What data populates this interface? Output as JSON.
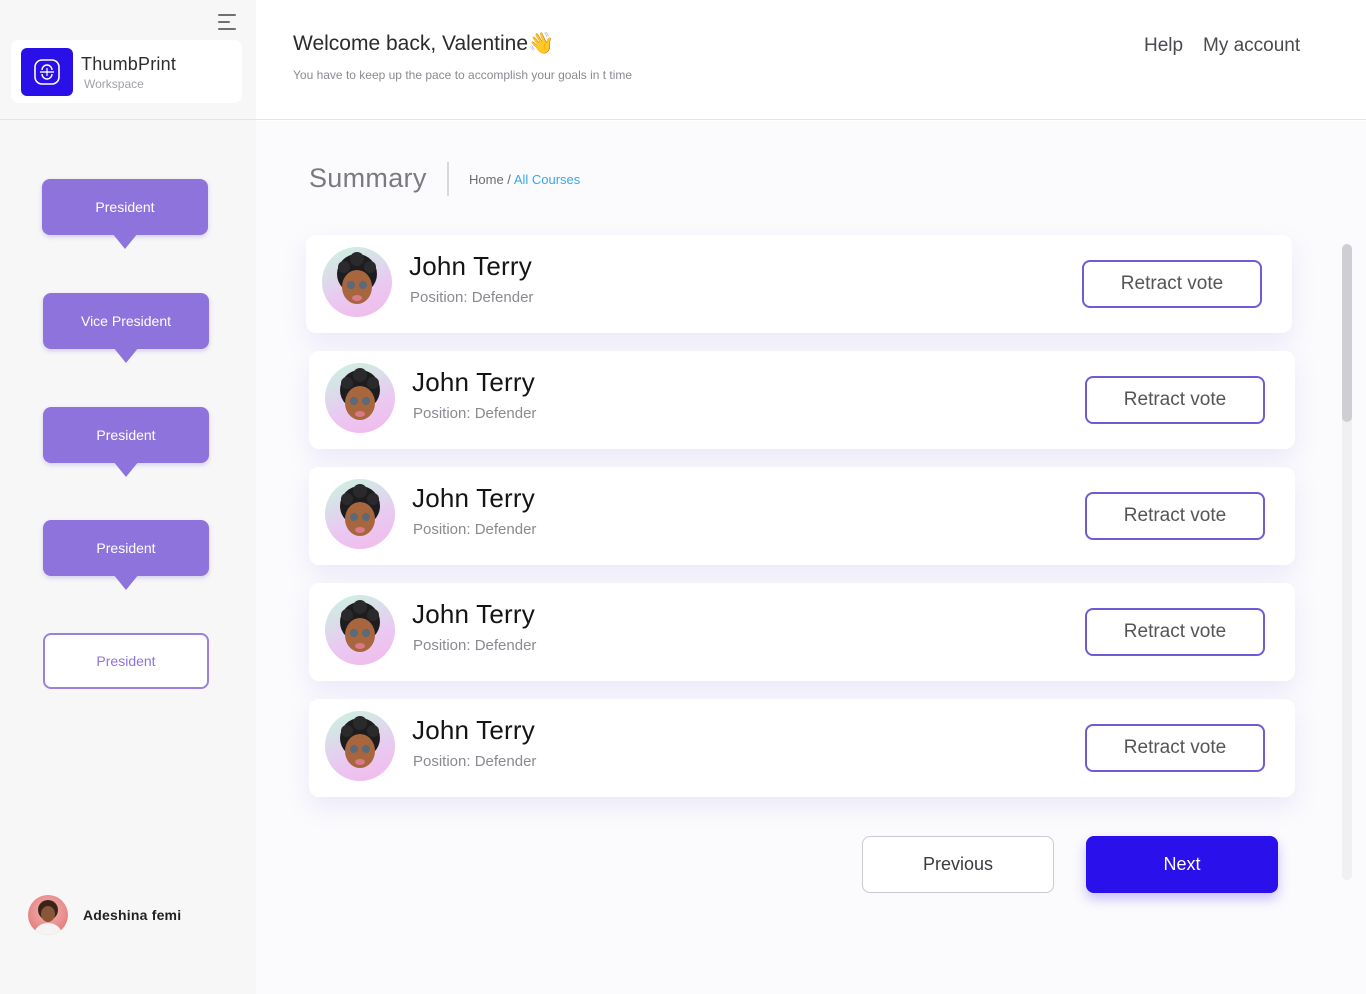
{
  "brand": {
    "name": "ThumbPrint",
    "subtitle": "Workspace",
    "logo_icon": "fingerprint-scan-icon",
    "logo_color": "#2a10e8"
  },
  "sidebar": {
    "menu_icon": "hamburger-menu-icon",
    "positions": [
      {
        "label": "President",
        "style": "filled"
      },
      {
        "label": "Vice President",
        "style": "filled"
      },
      {
        "label": "President",
        "style": "filled"
      },
      {
        "label": "President",
        "style": "filled"
      },
      {
        "label": "President",
        "style": "outline"
      }
    ],
    "user": {
      "name": "Adeshina femi",
      "avatar_icon": "user-avatar"
    }
  },
  "header": {
    "welcome": "Welcome back, Valentine👋",
    "subtitle": "You have to keep up the pace to accomplish your goals in t time",
    "nav": {
      "help": "Help",
      "account": "My account"
    }
  },
  "main": {
    "title": "Summary",
    "breadcrumb": {
      "home": "Home",
      "separator": " / ",
      "current": "All Courses"
    },
    "candidates": [
      {
        "name": "John Terry",
        "position": "Position: Defender",
        "action": "Retract vote"
      },
      {
        "name": "John Terry",
        "position": "Position: Defender",
        "action": "Retract vote"
      },
      {
        "name": "John Terry",
        "position": "Position: Defender",
        "action": "Retract vote"
      },
      {
        "name": "John Terry",
        "position": "Position: Defender",
        "action": "Retract vote"
      },
      {
        "name": "John Terry",
        "position": "Position: Defender",
        "action": "Retract vote"
      }
    ],
    "pagination": {
      "previous": "Previous",
      "next": "Next"
    }
  },
  "colors": {
    "accent": "#2a10ea",
    "position_button": "#8f73dd",
    "retract_border": "#6f5bd4",
    "breadcrumb_link": "#3aa6e8"
  }
}
